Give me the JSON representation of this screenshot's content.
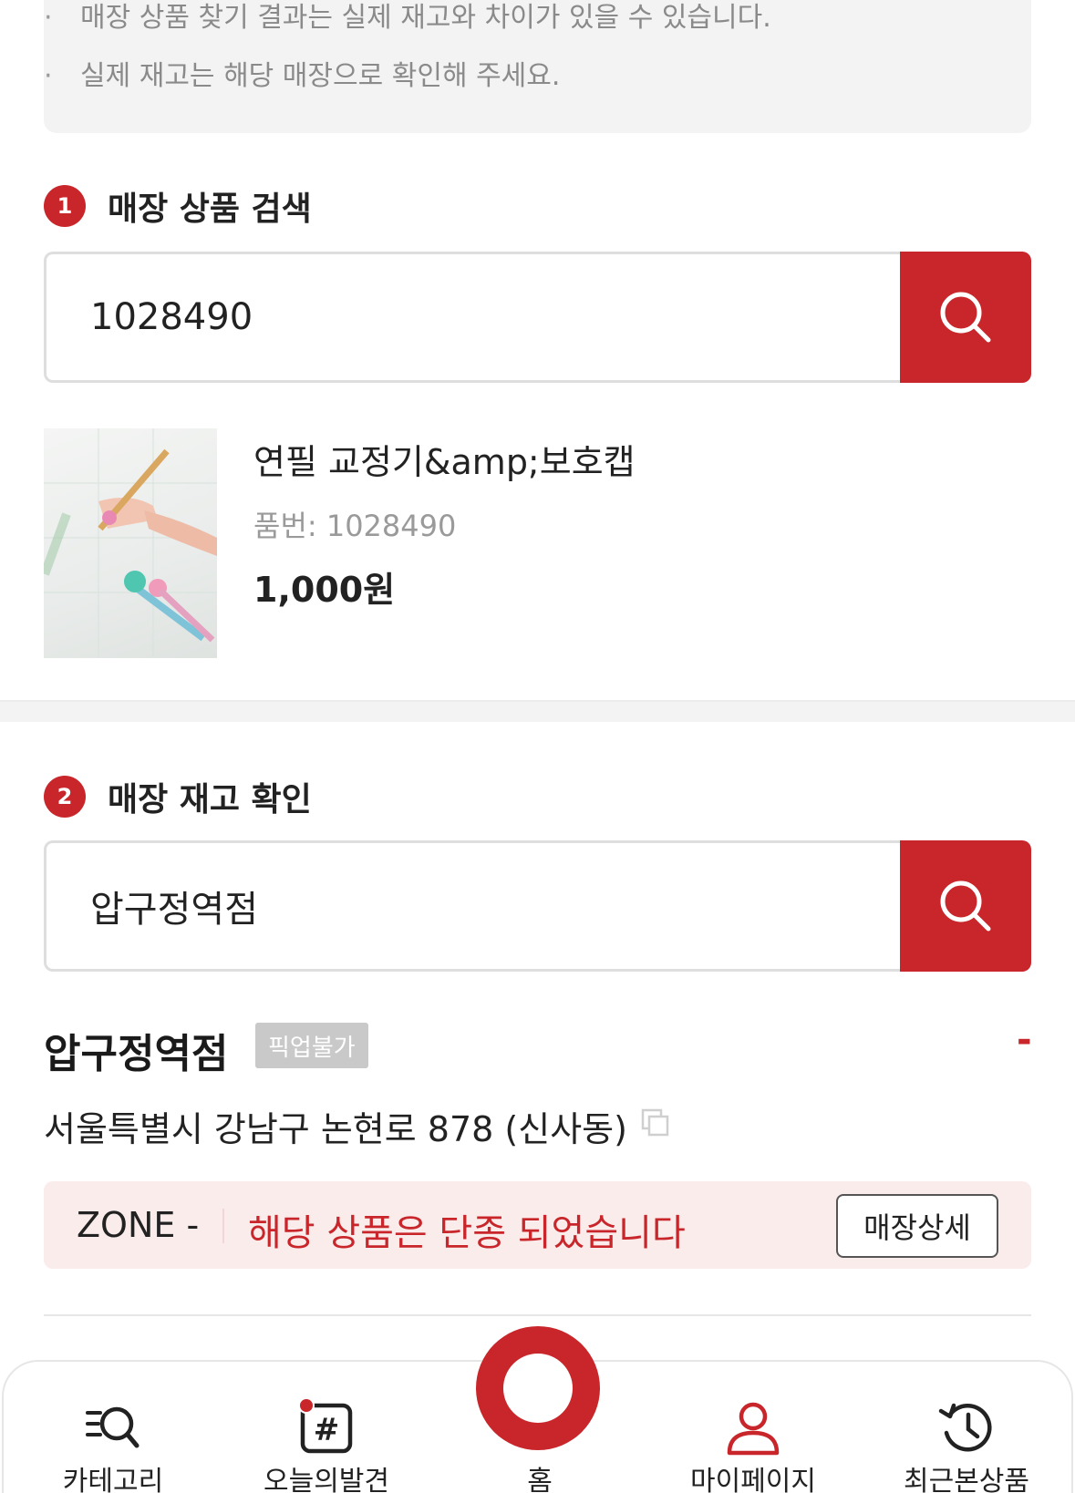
{
  "notice": {
    "line1": "매장 상품 찾기 결과는 실제 재고와 차이가 있을 수 있습니다.",
    "line2": "실제 재고는 해당 매장으로 확인해 주세요."
  },
  "section1": {
    "step": "1",
    "title": "매장 상품 검색",
    "search_value": "1028490"
  },
  "product": {
    "name": "연필 교정기&amp;보호캡",
    "code": "품번: 1028490",
    "price": "1,000원"
  },
  "section2": {
    "step": "2",
    "title": "매장 재고 확인",
    "search_value": "압구정역점"
  },
  "store": {
    "name": "압구정역점",
    "pickup_badge": "픽업불가",
    "toggle": "-",
    "address": "서울특별시 강남구 논현로 878 (신사동)",
    "zone_label": "ZONE -",
    "zone_message": "해당 상품은 단종 되었습니다",
    "detail_button": "매장상세"
  },
  "tabbar": {
    "category": "카테고리",
    "discover": "오늘의발견",
    "home": "홈",
    "mypage": "마이페이지",
    "recent": "최근본상품"
  },
  "colors": {
    "accent": "#c8262a",
    "notice_bg": "#f3f3f3",
    "zone_bg": "#fbecec",
    "badge_bg": "#c9c9c9"
  }
}
